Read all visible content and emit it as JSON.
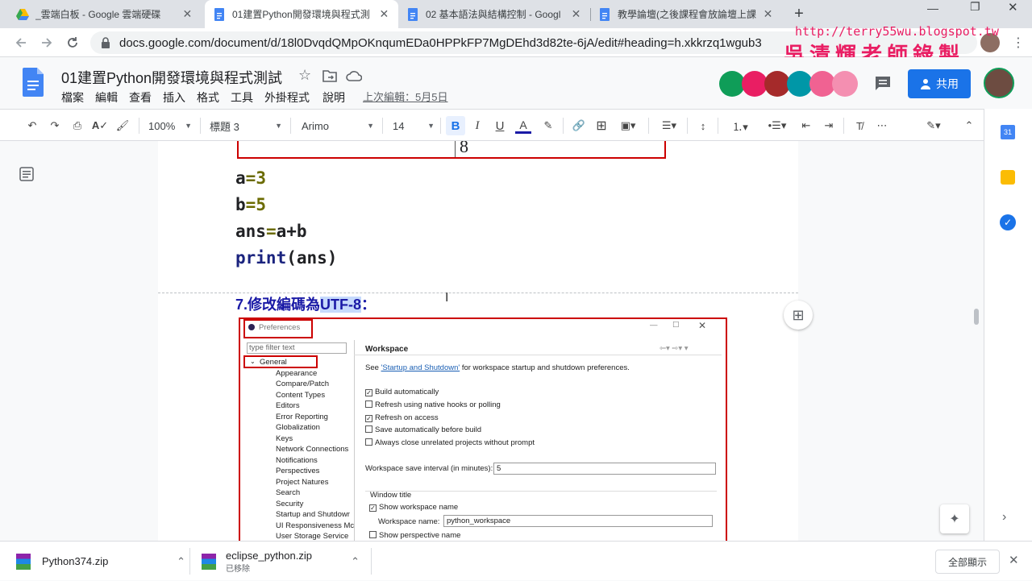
{
  "tabs": [
    {
      "title": "_雲端白板 - Google 雲端硬碟",
      "icon": "drive-icon"
    },
    {
      "title": "01建置Python開發環境與程式測",
      "icon": "docs-icon",
      "active": true
    },
    {
      "title": "02 基本語法與結構控制 - Googl",
      "icon": "docs-icon"
    },
    {
      "title": "教學論壇(之後課程會放論壇上課",
      "icon": "docs-icon"
    }
  ],
  "browser": {
    "url": "docs.google.com/document/d/18l0DvqdQMpOKnqumEDa0HPPkFP7MgDEhd3d82te-6jA/edit#heading=h.xkkrzq1wgub3"
  },
  "watermark": {
    "url": "http://terry55wu.blogspot.tw",
    "text": "吳清輝老師錄製"
  },
  "doc": {
    "title": "01建置Python開發環境與程式測試",
    "menu": [
      "檔案",
      "編輯",
      "查看",
      "插入",
      "格式",
      "工具",
      "外掛程式",
      "說明"
    ],
    "last_edit": "上次編輯：5月5日",
    "share_label": "共用"
  },
  "toolbar": {
    "zoom": "100%",
    "style": "標題 3",
    "font": "Arimo",
    "size": "14"
  },
  "content": {
    "table_cell_value": "8",
    "code_lines": [
      {
        "var": "a",
        "op": "=",
        "val": "3"
      },
      {
        "var": "b",
        "op": "=",
        "val": "5"
      },
      {
        "var": "ans",
        "op": "=",
        "val": "a+b"
      }
    ],
    "print_kw": "print",
    "print_args": "(ans)",
    "heading_prefix": "7.修改編碼為",
    "heading_highlight": "UTF-8",
    "heading_suffix": "："
  },
  "eclipse": {
    "window_title": "Preferences",
    "filter_placeholder": "type filter text",
    "tree": [
      "General",
      "Appearance",
      "Compare/Patch",
      "Content Types",
      "Editors",
      "Error Reporting",
      "Globalization",
      "Keys",
      "Network Connections",
      "Notifications",
      "Perspectives",
      "Project Natures",
      "Search",
      "Security",
      "Startup and Shutdowr",
      "UI Responsiveness Mc",
      "User Storage Service"
    ],
    "panel_title": "Workspace",
    "see_prefix": "See ",
    "see_link": "'Startup and Shutdown'",
    "see_suffix": " for workspace startup and shutdown preferences.",
    "options": [
      {
        "label": "Build automatically",
        "checked": true
      },
      {
        "label": "Refresh using native hooks or polling",
        "checked": false
      },
      {
        "label": "Refresh on access",
        "checked": true
      },
      {
        "label": "Save automatically before build",
        "checked": false
      },
      {
        "label": "Always close unrelated projects without prompt",
        "checked": false
      }
    ],
    "save_interval_label": "Workspace save interval (in minutes):",
    "save_interval_value": "5",
    "window_title_group": "Window title",
    "show_ws_name": "Show workspace name",
    "ws_name_label": "Workspace name:",
    "ws_name_value": "python_workspace",
    "show_perspective": "Show perspective name"
  },
  "downloads": [
    {
      "name": "Python374.zip",
      "sub": ""
    },
    {
      "name": "eclipse_python.zip",
      "sub": "已移除"
    }
  ],
  "show_all": "全部顯示"
}
